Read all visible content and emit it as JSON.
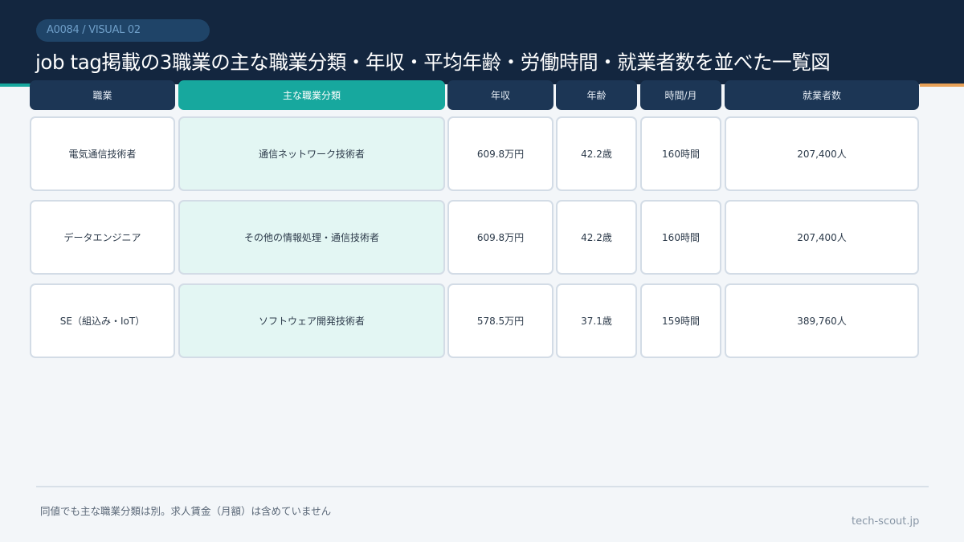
{
  "header": {
    "badge": "A0084 / VISUAL 02",
    "title": "job tag掲載の3職業の主な職業分類・年収・平均年齢・労働時間・就業者数を並べた一覧図"
  },
  "table": {
    "columns": [
      "職業",
      "主な職業分類",
      "年収",
      "年齢",
      "時間/月",
      "就業者数"
    ],
    "rows": [
      [
        "電気通信技術者",
        "通信ネットワーク技術者",
        "609.8万円",
        "42.2歳",
        "160時間",
        "207,400人"
      ],
      [
        "データエンジニア",
        "その他の情報処理・通信技術者",
        "609.8万円",
        "42.2歳",
        "160時間",
        "207,400人"
      ],
      [
        "SE（組込み・IoT）",
        "ソフトウェア開発技術者",
        "578.5万円",
        "37.1歳",
        "159時間",
        "389,760人"
      ]
    ]
  },
  "footer": {
    "note": "同値でも主な職業分類は別。求人賃金（月額）は含めていません",
    "site": "tech-scout.jp"
  },
  "colors": {
    "header_bg": "#13263f",
    "table_header_bg": "#1c3655",
    "highlight_accent": "#17a89e",
    "highlight_cell_bg": "#e3f6f3",
    "orange_accent": "#e8a157"
  }
}
